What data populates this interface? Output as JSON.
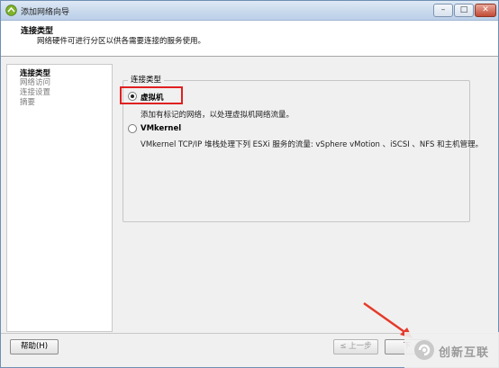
{
  "window": {
    "title": "添加网络向导"
  },
  "header": {
    "title": "连接类型",
    "description": "网络硬件可进行分区以供各需要连接的服务使用。"
  },
  "nav": {
    "items": [
      {
        "label": "连接类型",
        "active": true
      },
      {
        "label": "网络访问",
        "active": false
      },
      {
        "label": "连接设置",
        "active": false
      },
      {
        "label": "摘要",
        "active": false
      }
    ]
  },
  "content": {
    "group_label": "连接类型",
    "options": [
      {
        "label": "虚拟机",
        "selected": true,
        "description": "添加有标记的网络，以处理虚拟机网络流量。"
      },
      {
        "label": "VMkernel",
        "selected": false,
        "description": "VMkernel TCP/IP 堆栈处理下列 ESXi 服务的流量: vSphere vMotion 、iSCSI 、NFS 和主机管理。"
      }
    ]
  },
  "buttons": {
    "help": "帮助(H)",
    "back": "≤ 上一步",
    "next": "下"
  },
  "watermark": {
    "text": "创新互联"
  },
  "colors": {
    "highlight": "#e02020",
    "arrow": "#e53a2a"
  }
}
